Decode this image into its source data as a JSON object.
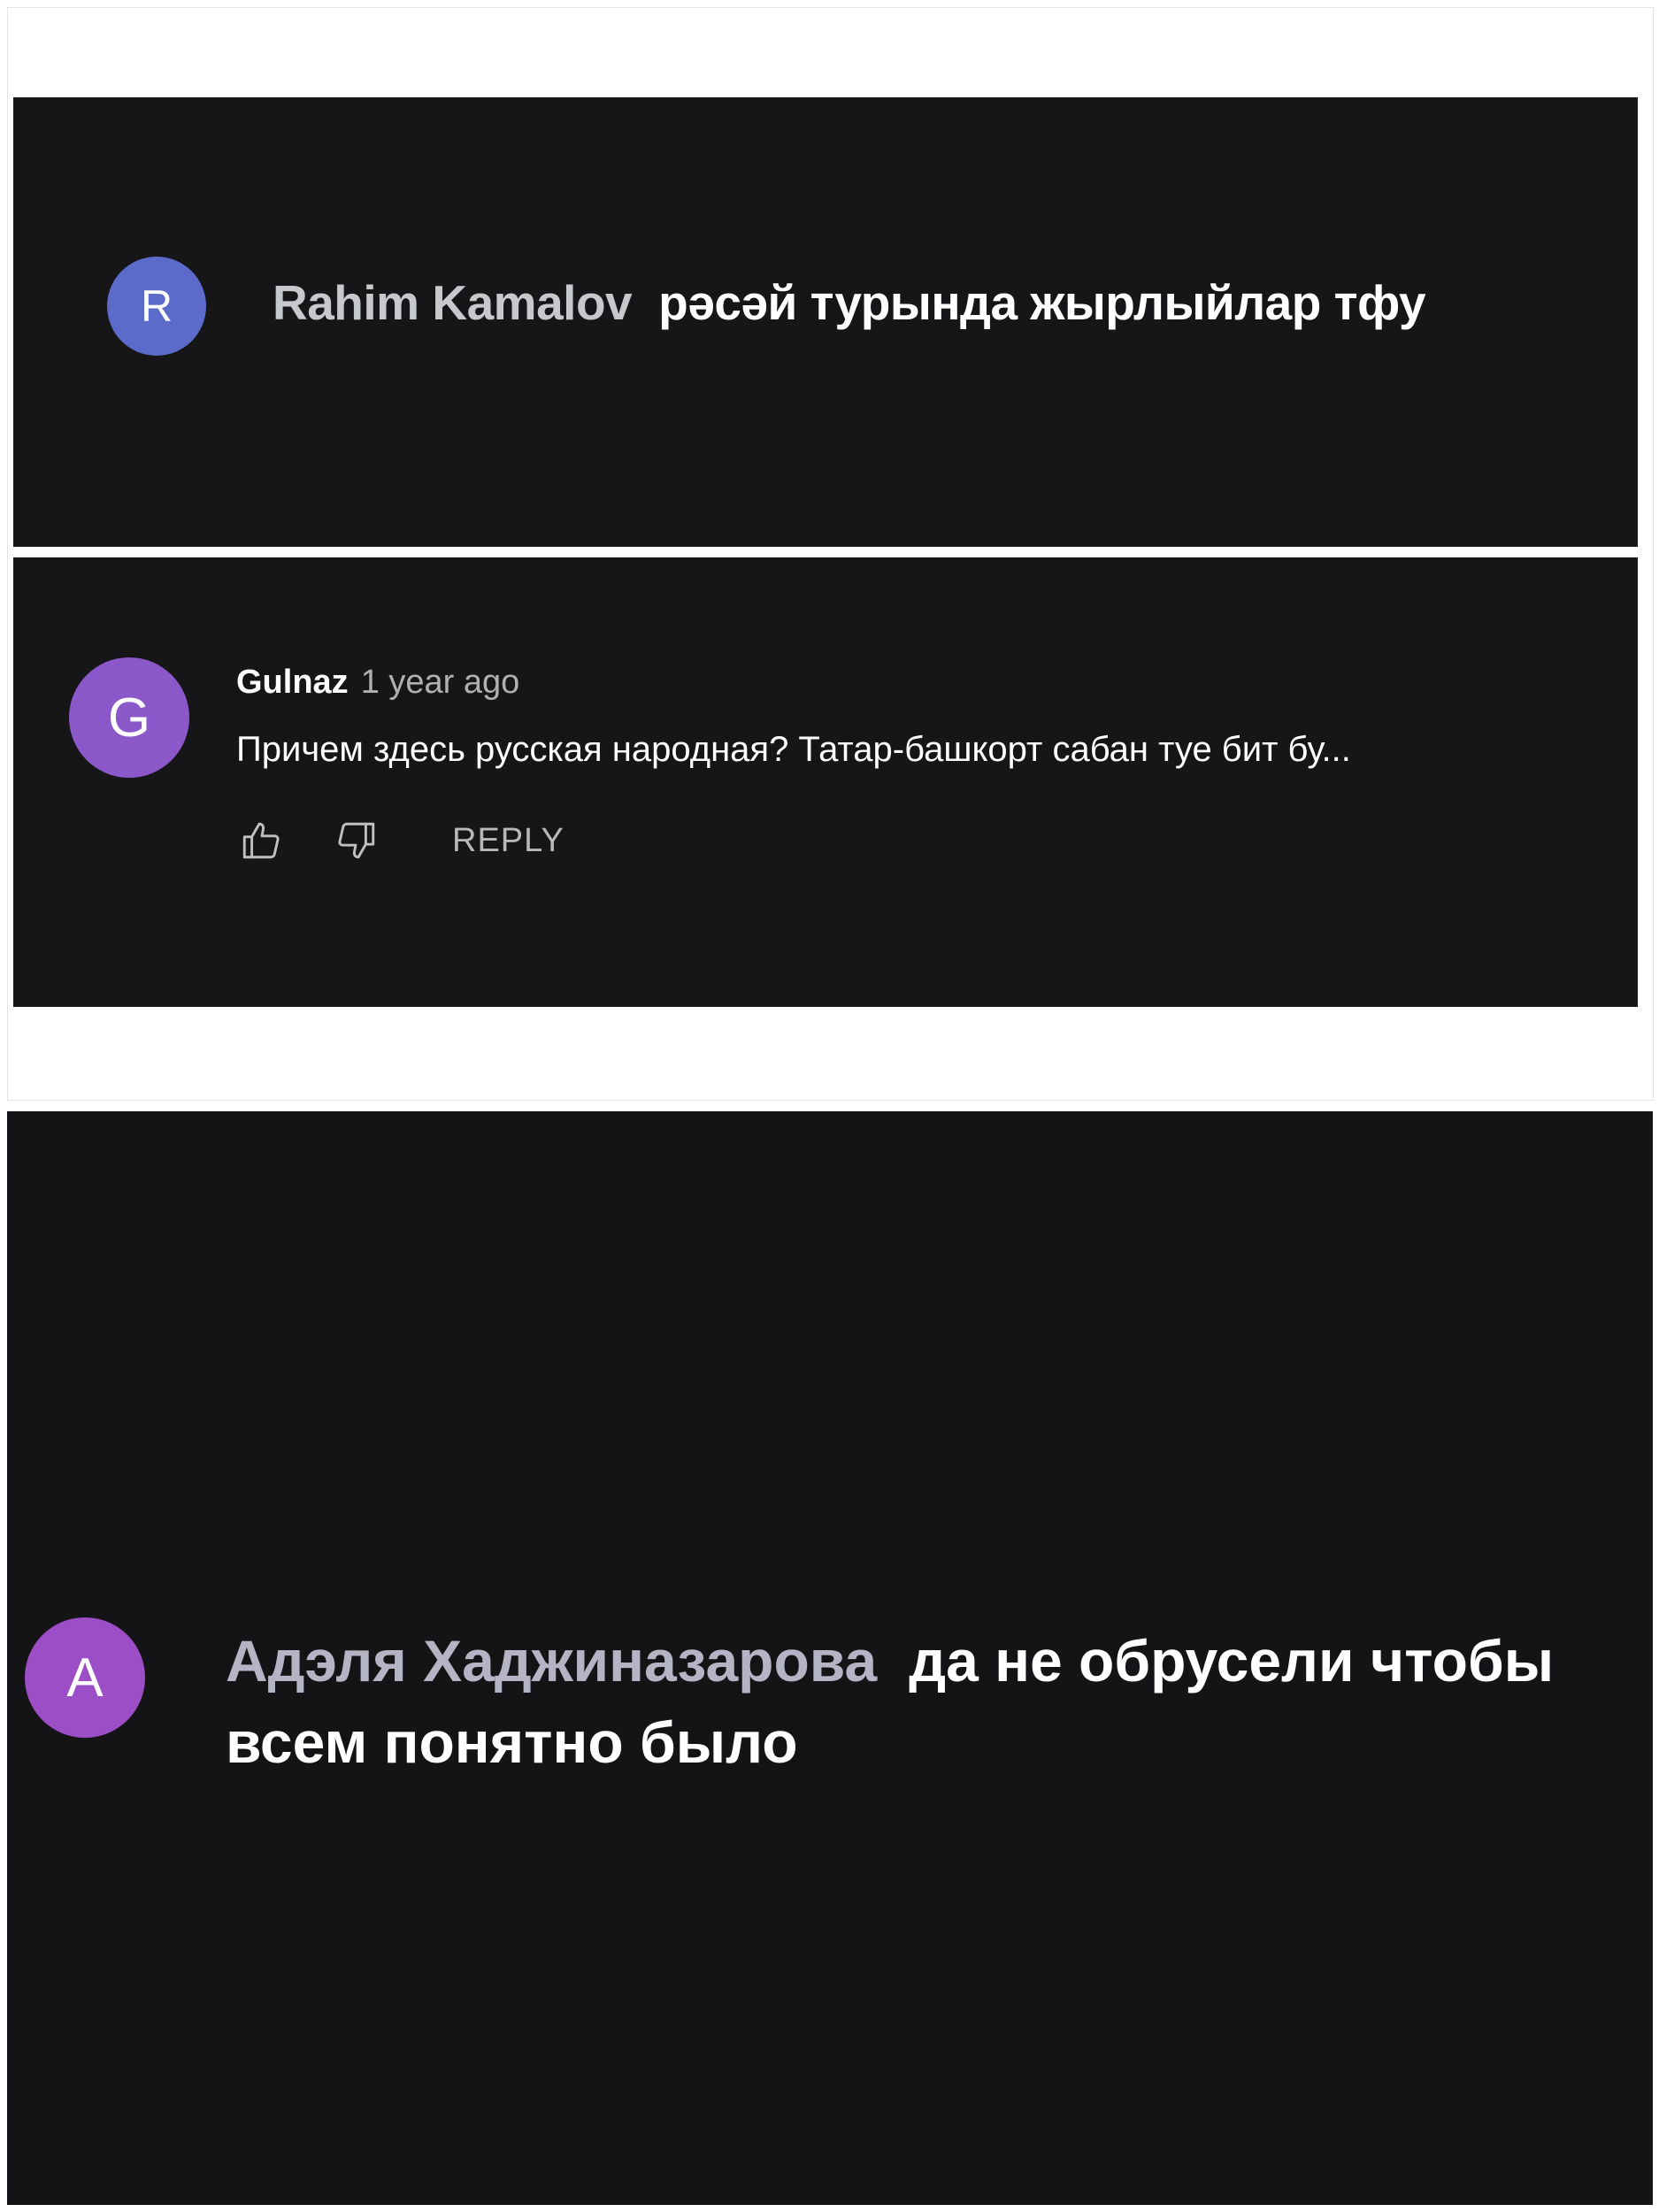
{
  "comments": [
    {
      "avatar_letter": "R",
      "author": "Rahim Kamalov",
      "text": "рәсәй турында жырлыйлар тфу",
      "avatar_color": "#5c6bc9"
    },
    {
      "avatar_letter": "G",
      "author": "Gulnaz",
      "time": "1 year ago",
      "text": "Причем здесь русская народная? Татар-башкорт сабан туе бит бу...",
      "reply_label": "REPLY",
      "like_icon": "thumbs-up-icon",
      "dislike_icon": "thumbs-down-icon",
      "avatar_color": "#8b58c9"
    },
    {
      "avatar_letter": "A",
      "author": "Адэля Хаджиназарова",
      "text": "да не обрусели чтобы всем понятно было",
      "avatar_color": "#9c4ec7"
    }
  ],
  "colors": {
    "panel_background": "#161618",
    "page_background": "#ffffff",
    "author_text": "#c7c8cc",
    "comment_text": "#ffffff"
  }
}
